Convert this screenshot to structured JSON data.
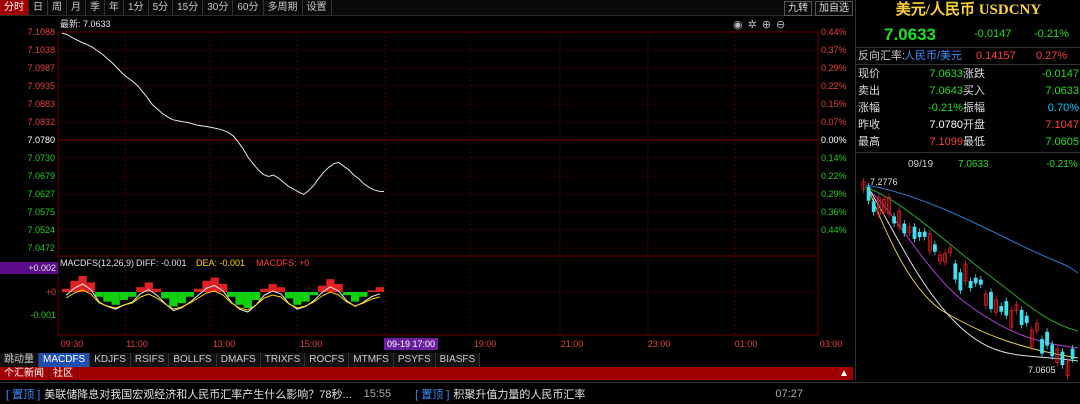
{
  "toolbar": {
    "tabs": [
      "分时",
      "日",
      "周",
      "月",
      "季",
      "年",
      "1分",
      "5分",
      "15分",
      "30分",
      "60分",
      "多周期",
      "设置"
    ],
    "active": 0,
    "right_buttons": [
      "九转",
      "加自选"
    ]
  },
  "chart": {
    "latest_label": "最新: 7.0633",
    "y_labels": [
      "7.1088",
      "7.1038",
      "7.0987",
      "7.0935",
      "7.0883",
      "7.0832",
      "7.0780",
      "7.0730",
      "7.0679",
      "7.0627",
      "7.0575",
      "7.0524",
      "7.0472"
    ],
    "pct_labels": [
      "0.44%",
      "0.37%",
      "0.29%",
      "0.22%",
      "0.15%",
      "0.07%",
      "0.00%",
      "0.14%",
      "0.22%",
      "0.29%",
      "0.36%",
      "0.44%"
    ],
    "x_labels": [
      "09:30",
      "11:00",
      "13:00",
      "15:00",
      "19:00",
      "21:00",
      "23:00",
      "01:00",
      "03:00"
    ],
    "cursor_time": "09-19 17:00",
    "macd_title": "MACDFS(12,26,9)",
    "diff": "DIFF: -0.001",
    "dea": "DEA: -0.001",
    "macdfs": "MACDFS: +0",
    "macd_labels": [
      "+0.002",
      "+0",
      "-0.001"
    ],
    "price_series": [
      7.1085,
      7.1081,
      7.1072,
      7.1065,
      7.1058,
      7.1052,
      7.1045,
      7.1035,
      7.1025,
      7.1012,
      7.1,
      7.0985,
      7.097,
      7.0958,
      7.0948,
      7.0935,
      7.0918,
      7.09,
      7.088,
      7.0868,
      7.0855,
      7.0846,
      7.0838,
      7.0835,
      7.0832,
      7.083,
      7.0826,
      7.0822,
      7.082,
      7.0818,
      7.0815,
      7.0812,
      7.0808,
      7.0802,
      7.0792,
      7.0775,
      7.0755,
      7.073,
      7.0712,
      7.0695,
      7.0682,
      7.0676,
      7.068,
      7.0672,
      7.066,
      7.0648,
      7.064,
      7.0632,
      7.0625,
      7.0635,
      7.065,
      7.067,
      7.0688,
      7.0702,
      7.0712,
      7.0716,
      7.0705,
      7.0695,
      7.068,
      7.067,
      7.0655,
      7.0645,
      7.0638,
      7.0634,
      7.0633
    ],
    "hist": [
      0.2,
      0.7,
      1,
      0.6,
      -0.3,
      -0.6,
      -0.8,
      -0.5,
      -0.3,
      0.3,
      0.6,
      0.2,
      -0.4,
      -0.9,
      -0.7,
      -0.3,
      0.2,
      0.7,
      0.9,
      0.5,
      -0.3,
      -0.8,
      -1,
      -0.5,
      0.2,
      0.5,
      0.3,
      -0.4,
      -0.8,
      -0.6,
      -0.2,
      0.4,
      0.8,
      0.5,
      -0.2,
      -0.6,
      -0.3,
      0.1,
      0.3
    ]
  },
  "bottom_tabs": [
    "跳动量",
    "MACDFS",
    "KDJFS",
    "RSIFS",
    "BOLLFS",
    "DMAFS",
    "TRIXFS",
    "ROCFS",
    "MTMFS",
    "PSYFS",
    "BIASFS"
  ],
  "bottom_active": 1,
  "news_tabs": [
    "个汇新闻",
    "社区"
  ],
  "ticker": [
    {
      "tag": "[ 置顶 ]",
      "text": "美联储降息对我国宏观经济和人民币汇率产生什么影响？78秒...",
      "time": "15:55"
    },
    {
      "tag": "[ 置顶 ]",
      "text": "积聚升值力量的人民币汇率",
      "time": "07:27"
    }
  ],
  "panel": {
    "title": "美元/人民币 USDCNY",
    "price": "7.0633",
    "change": "-0.0147",
    "change_pct": "-0.21%",
    "reverse_label": "反向汇率:",
    "reverse_pair": "人民币/美元",
    "reverse_price": "0.14157",
    "reverse_pct": "0.27%",
    "rows": [
      {
        "l": "现价",
        "v": "7.0633",
        "vc": "#22dd22",
        "l2": "涨跌",
        "v2": "-0.0147",
        "v2c": "#22dd22"
      },
      {
        "l": "卖出",
        "v": "7.0643",
        "vc": "#22dd22",
        "l2": "买入",
        "v2": "7.0633",
        "v2c": "#22dd22"
      },
      {
        "l": "涨幅",
        "v": "-0.21%",
        "vc": "#22dd22",
        "l2": "振幅",
        "v2": "0.70%",
        "v2c": "#00c8ff"
      },
      {
        "l": "昨收",
        "v": "7.0780",
        "vc": "#ffffff",
        "l2": "开盘",
        "v2": "7.1047",
        "v2c": "#ff4040"
      },
      {
        "l": "最高",
        "v": "7.1099",
        "vc": "#ff4040",
        "l2": "最低",
        "v2": "7.0605",
        "v2c": "#22dd22"
      }
    ],
    "mini_date": "09/19",
    "mini_price": "7.0633",
    "mini_pct": "-0.21%",
    "mini_high": "7.2776",
    "mini_low": "7.0605"
  }
}
